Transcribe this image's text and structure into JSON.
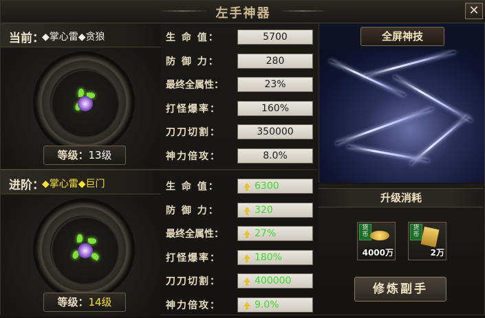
{
  "window": {
    "title": "左手神器",
    "close_label": "✕"
  },
  "current": {
    "label": "当前：",
    "name": "◆掌心雷◆贪狼",
    "level_label": "等级：",
    "level_value": "13级",
    "stats": [
      {
        "label": "生 命 值：",
        "value": "5700"
      },
      {
        "label": "防 御 力：",
        "value": "280"
      },
      {
        "label": "最终全属性：",
        "value": "23%"
      },
      {
        "label": "打怪爆率：",
        "value": "160%"
      },
      {
        "label": "刀刀切割：",
        "value": "350000"
      },
      {
        "label": "神力倍攻：",
        "value": "8.0%"
      }
    ]
  },
  "next": {
    "label": "进阶：",
    "name": "◆掌心雷◆巨门",
    "level_label": "等级：",
    "level_value": "14级",
    "stats": [
      {
        "label": "生 命 值：",
        "value": "6300"
      },
      {
        "label": "防 御 力：",
        "value": "320"
      },
      {
        "label": "最终全属性：",
        "value": "27%"
      },
      {
        "label": "打怪爆率：",
        "value": "180%"
      },
      {
        "label": "刀刀切割：",
        "value": "400000"
      },
      {
        "label": "神力倍攻：",
        "value": "9.0%"
      }
    ]
  },
  "skill_panel": {
    "title": "全屏神技"
  },
  "cost_panel": {
    "title": "升级消耗",
    "items": [
      {
        "badge": "货币",
        "amount": "4000万",
        "icon": "gold-ingot-icon"
      },
      {
        "badge": "货币",
        "amount": "2万",
        "icon": "scroll-icon"
      }
    ],
    "action_label": "修炼副手"
  },
  "colors": {
    "upgrade_value": "#3fd828",
    "next_name": "#f7e23b",
    "arrow": "#e6c23a"
  }
}
